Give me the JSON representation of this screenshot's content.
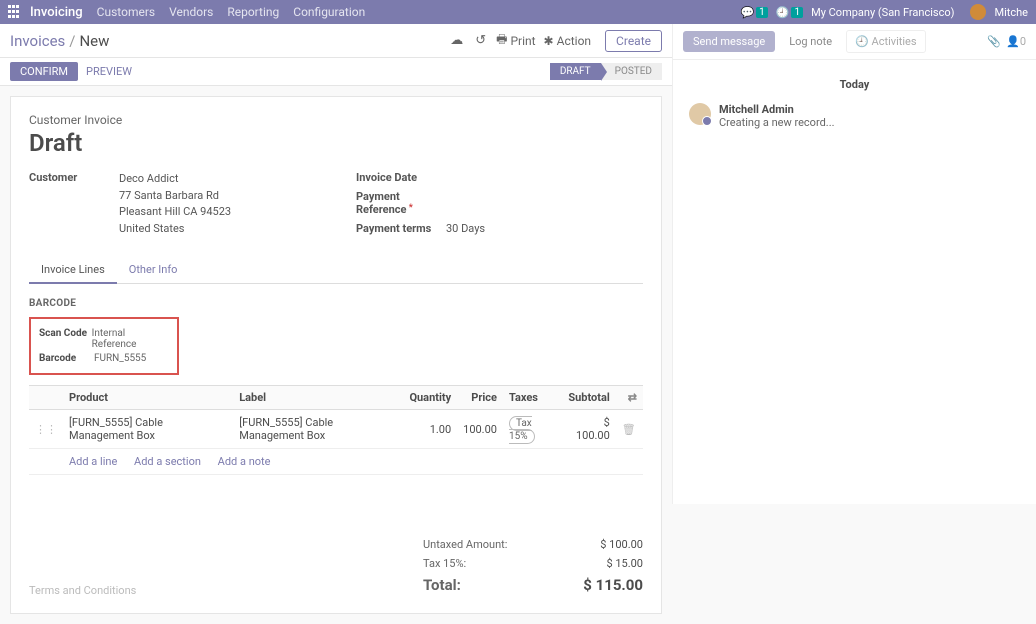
{
  "nav": {
    "brand": "Invoicing",
    "items": [
      "Customers",
      "Vendors",
      "Reporting",
      "Configuration"
    ],
    "msg_count": "1",
    "act_count": "1",
    "company": "My Company (San Francisco)",
    "user_short": "Mitche"
  },
  "breadcrumb": {
    "root": "Invoices",
    "current": "New"
  },
  "toolbar": {
    "print": "Print",
    "action": "Action",
    "create": "Create"
  },
  "chatter": {
    "send": "Send message",
    "log": "Log note",
    "activities": "Activities",
    "follow_count": "0",
    "today": "Today",
    "msg_name": "Mitchell Admin",
    "msg_body": "Creating a new record..."
  },
  "status": {
    "confirm": "CONFIRM",
    "preview": "PREVIEW",
    "draft": "DRAFT",
    "posted": "POSTED"
  },
  "header": {
    "type": "Customer Invoice",
    "title": "Draft"
  },
  "fields": {
    "customer_lbl": "Customer",
    "customer_name": "Deco Addict",
    "addr1": "77 Santa Barbara Rd",
    "addr2": "Pleasant Hill CA 94523",
    "addr3": "United States",
    "inv_date_lbl": "Invoice Date",
    "inv_date": "",
    "pay_ref_lbl": "Payment Reference",
    "pay_ref": "",
    "pay_terms_lbl": "Payment terms",
    "pay_terms": "30 Days"
  },
  "tabs": {
    "lines": "Invoice Lines",
    "other": "Other Info"
  },
  "barcode": {
    "section": "BARCODE",
    "scan_lbl": "Scan Code",
    "scan_val": "Internal Reference",
    "bc_lbl": "Barcode",
    "bc_val": "FURN_5555"
  },
  "table": {
    "cols": {
      "product": "Product",
      "label": "Label",
      "qty": "Quantity",
      "price": "Price",
      "taxes": "Taxes",
      "subtotal": "Subtotal"
    },
    "row": {
      "product": "[FURN_5555] Cable Management Box",
      "label": "[FURN_5555] Cable Management Box",
      "qty": "1.00",
      "price": "100.00",
      "tax": "Tax 15%",
      "subtotal": "$ 100.00"
    },
    "add_line": "Add a line",
    "add_section": "Add a section",
    "add_note": "Add a note"
  },
  "terms": "Terms and Conditions",
  "totals": {
    "untaxed_lbl": "Untaxed Amount:",
    "untaxed": "$ 100.00",
    "tax_lbl": "Tax 15%:",
    "tax": "$ 15.00",
    "total_lbl": "Total:",
    "total": "$ 115.00"
  }
}
